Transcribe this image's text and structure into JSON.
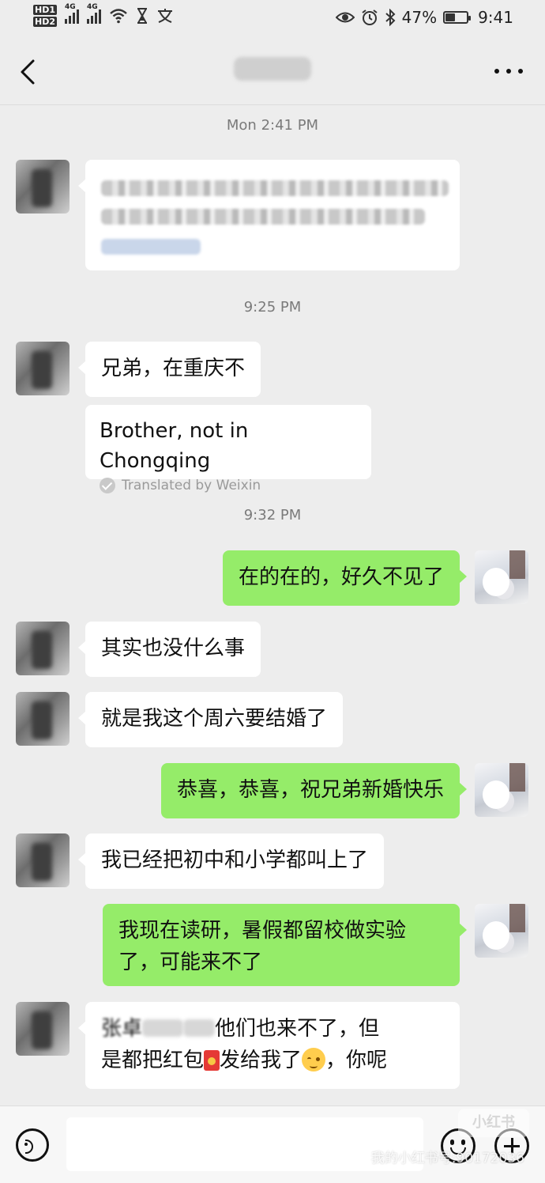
{
  "status_bar": {
    "sim_labels": [
      "HD1",
      "HD2"
    ],
    "network_1": "4G",
    "network_2": "4G",
    "battery": "47%",
    "battery_level": 0.47,
    "clock": "9:41",
    "icons": [
      "hd-icon",
      "signal-icon",
      "wifi-icon",
      "hourglass-icon",
      "translate-icon",
      "eye-icon",
      "alarm-icon",
      "bluetooth-icon",
      "battery-icon"
    ]
  },
  "header": {
    "back_icon": "chevron-left-icon",
    "more_icon": "more-dots-icon"
  },
  "chat": {
    "timestamps": [
      "Mon 2:41 PM",
      "9:25 PM",
      "9:32 PM"
    ],
    "messages": [
      {
        "side": "in",
        "text": "兄弟，在重庆不"
      },
      {
        "side": "in",
        "translation": "Brother, not in Chongqing",
        "translation_note": "Translated by Weixin"
      },
      {
        "side": "out",
        "text": "在的在的，好久不见了"
      },
      {
        "side": "in",
        "text": "其实也没什么事"
      },
      {
        "side": "in",
        "text": "就是我这个周六要结婚了"
      },
      {
        "side": "out",
        "text": "恭喜，恭喜，祝兄弟新婚快乐"
      },
      {
        "side": "in",
        "text": "我已经把初中和小学都叫上了"
      },
      {
        "side": "out",
        "line1": "我现在读研，暑假都留校做实验",
        "line2": "了，可能来不了"
      },
      {
        "side": "in",
        "line1_a": "张卓",
        "line1_b": "他们也来不了，但",
        "line2_a": "是都把红包",
        "line2_b": "发给我了",
        "line2_c": "，你呢"
      }
    ]
  },
  "input_bar": {
    "voice_icon": "voice-icon",
    "emoji_icon": "emoji-icon",
    "plus_icon": "plus-icon",
    "input_value": ""
  },
  "watermark": {
    "logo": "小红书",
    "text": "我的小红书号:90172036"
  }
}
